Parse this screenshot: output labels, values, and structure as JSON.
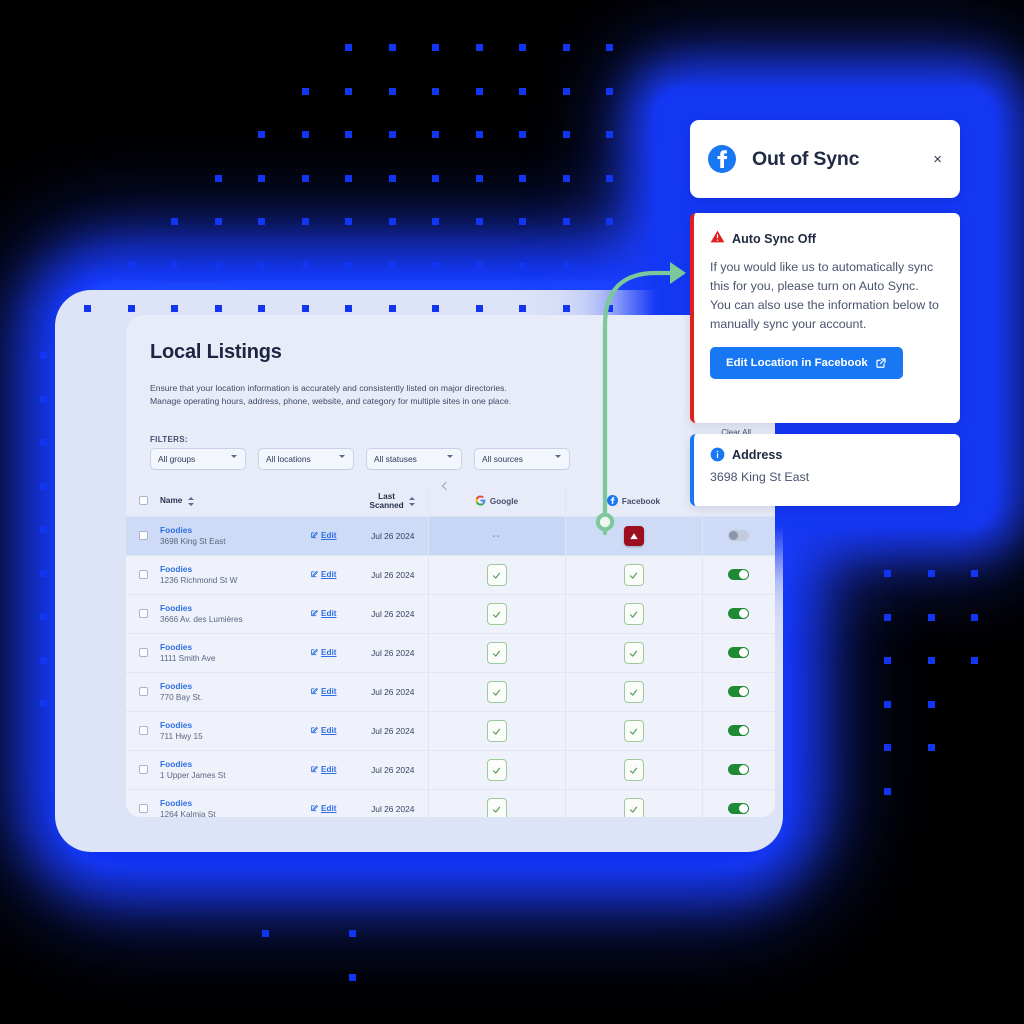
{
  "card": {
    "title": "Local Listings",
    "subtitle_line1": "Ensure that your location information is accurately and consistently listed on major directories.",
    "subtitle_line2": "Manage operating hours, address, phone, website, and category for multiple sites in one place.",
    "filters_label": "FILTERS:",
    "clear_all": "Clear All",
    "filters": [
      {
        "name": "groups-filter",
        "value": "All groups"
      },
      {
        "name": "locations-filter",
        "value": "All locations"
      },
      {
        "name": "statuses-filter",
        "value": "All statuses"
      },
      {
        "name": "sources-filter",
        "value": "All sources"
      }
    ]
  },
  "table": {
    "headers": {
      "name": "Name",
      "last_scanned_line1": "Last",
      "last_scanned_line2": "Scanned",
      "google": "Google",
      "facebook": "Facebook",
      "prev_icon": "chevron-left-icon"
    },
    "edit_label": "Edit",
    "rows": [
      {
        "business": "Foodies",
        "address": "3698 King St East",
        "last_scanned": "Jul 26 2024",
        "google": "dash",
        "google_text": "--",
        "facebook": "error",
        "toggle": "off",
        "selected": true
      },
      {
        "business": "Foodies",
        "address": "1236 Richmond St W",
        "last_scanned": "Jul 26 2024",
        "google": "ok",
        "google_text": "",
        "facebook": "ok",
        "toggle": "on",
        "selected": false
      },
      {
        "business": "Foodies",
        "address": "3666 Av. des Lumières",
        "last_scanned": "Jul 26 2024",
        "google": "ok",
        "google_text": "",
        "facebook": "ok",
        "toggle": "on",
        "selected": false
      },
      {
        "business": "Foodies",
        "address": "1111 Smith Ave",
        "last_scanned": "Jul 26 2024",
        "google": "ok",
        "google_text": "",
        "facebook": "ok",
        "toggle": "on",
        "selected": false
      },
      {
        "business": "Foodies",
        "address": "770 Bay St.",
        "last_scanned": "Jul 26 2024",
        "google": "ok",
        "google_text": "",
        "facebook": "ok",
        "toggle": "on",
        "selected": false
      },
      {
        "business": "Foodies",
        "address": "711 Hwy 15",
        "last_scanned": "Jul 26 2024",
        "google": "ok",
        "google_text": "",
        "facebook": "ok",
        "toggle": "on",
        "selected": false
      },
      {
        "business": "Foodies",
        "address": "1 Upper James St",
        "last_scanned": "Jul 26 2024",
        "google": "ok",
        "google_text": "",
        "facebook": "ok",
        "toggle": "on",
        "selected": false
      },
      {
        "business": "Foodies",
        "address": "1264 Kalmia St",
        "last_scanned": "Jul 26 2024",
        "google": "ok",
        "google_text": "",
        "facebook": "ok",
        "toggle": "on",
        "selected": false
      }
    ]
  },
  "popup_header": {
    "icon": "facebook-icon",
    "title": "Out of Sync",
    "close_label": "×"
  },
  "popup_warning": {
    "icon": "warning-triangle-icon",
    "title": "Auto Sync Off",
    "body": "If you would like us to automatically sync this for you, please turn on Auto Sync. You can also use the information below to manually sync your account.",
    "button_label": "Edit Location in Facebook",
    "button_icon": "external-link-icon"
  },
  "popup_address": {
    "icon": "info-circle-icon",
    "title": "Address",
    "value": "3698 King St East"
  },
  "colors": {
    "background": "#000000",
    "glow_blue": "#1437f4",
    "dot_blue": "#1235f2",
    "brand_blue": "#1877f2",
    "link_blue": "#2f6fe4",
    "error_red": "#e02020",
    "error_badge": "#9d0f1f",
    "success_green": "#1f8a35",
    "arrow_green": "#7cc89a",
    "card_bg": "#e8ecf8",
    "row_selected": "#cddbf6"
  }
}
